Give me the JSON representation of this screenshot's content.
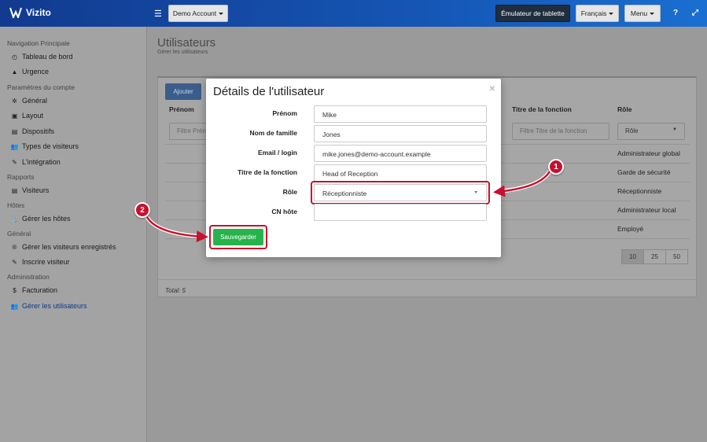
{
  "topbar": {
    "brand": "Vizito",
    "account_label": "Demo Account",
    "tablet_emulator_label": "Émulateur de tablette",
    "language_label": "Français",
    "menu_label": "Menu",
    "help_glyph": "?",
    "expand_glyph": "⤢"
  },
  "sidebar": {
    "sections": [
      {
        "title": "Navigation Principale",
        "items": [
          {
            "label": "Tableau de bord",
            "icon": "dashboard-icon"
          },
          {
            "label": "Urgence",
            "icon": "warning-icon"
          }
        ]
      },
      {
        "title": "Paramètres du compte",
        "items": [
          {
            "label": "Général",
            "icon": "gear-icon"
          },
          {
            "label": "Layout",
            "icon": "image-icon"
          },
          {
            "label": "Dispositifs",
            "icon": "tablet-icon"
          },
          {
            "label": "Types de visiteurs",
            "icon": "users-icon"
          },
          {
            "label": "L'intégration",
            "icon": "plug-icon"
          }
        ]
      },
      {
        "title": "Rapports",
        "items": [
          {
            "label": "Visiteurs",
            "icon": "list-icon"
          }
        ]
      },
      {
        "title": "Hôtes",
        "items": [
          {
            "label": "Gérer les hôtes",
            "icon": "host-icon"
          }
        ]
      },
      {
        "title": "Général",
        "items": [
          {
            "label": "Gérer les visiteurs enregistrés",
            "icon": "registered-icon"
          },
          {
            "label": "Inscrire visiteur",
            "icon": "pencil-icon"
          }
        ]
      },
      {
        "title": "Administration",
        "items": [
          {
            "label": "Facturation",
            "icon": "dollar-icon"
          },
          {
            "label": "Gérer les utilisateurs",
            "icon": "manage-users-icon"
          }
        ]
      }
    ]
  },
  "page": {
    "title": "Utilisateurs",
    "subtitle": "Gérer les utilisateurs"
  },
  "table": {
    "add_label": "Ajouter",
    "columns": [
      "Prénom",
      "Titre de la fonction",
      "Rôle"
    ],
    "filter_first_name": "Filtre Prén",
    "filter_job_title": "Filtre Titre de la fonction",
    "role_filter_value": "Rôle",
    "role_values": [
      "Administrateur global",
      "Garde de sécurité",
      "Réceptionniste",
      "Administrateur local",
      "Employé"
    ],
    "page_sizes": [
      "10",
      "25",
      "50"
    ],
    "total_label": "Total: 5"
  },
  "modal": {
    "title": "Détails de l'utilisateur",
    "close_glyph": "×",
    "fields": {
      "first_name_label": "Prénom",
      "first_name_value": "Mike",
      "last_name_label": "Nom de famille",
      "last_name_value": "Jones",
      "email_label": "Email / login",
      "email_value": "mike.jones@demo-account.example",
      "job_title_label": "Titre de la fonction",
      "job_title_value": "Head of Reception",
      "role_label": "Rôle",
      "role_value": "Réceptionniste",
      "cn_host_label": "CN hôte",
      "cn_host_value": ""
    },
    "save_label": "Sauvegarder"
  },
  "callouts": {
    "one": "1",
    "two": "2",
    "color": "#c8102e"
  }
}
